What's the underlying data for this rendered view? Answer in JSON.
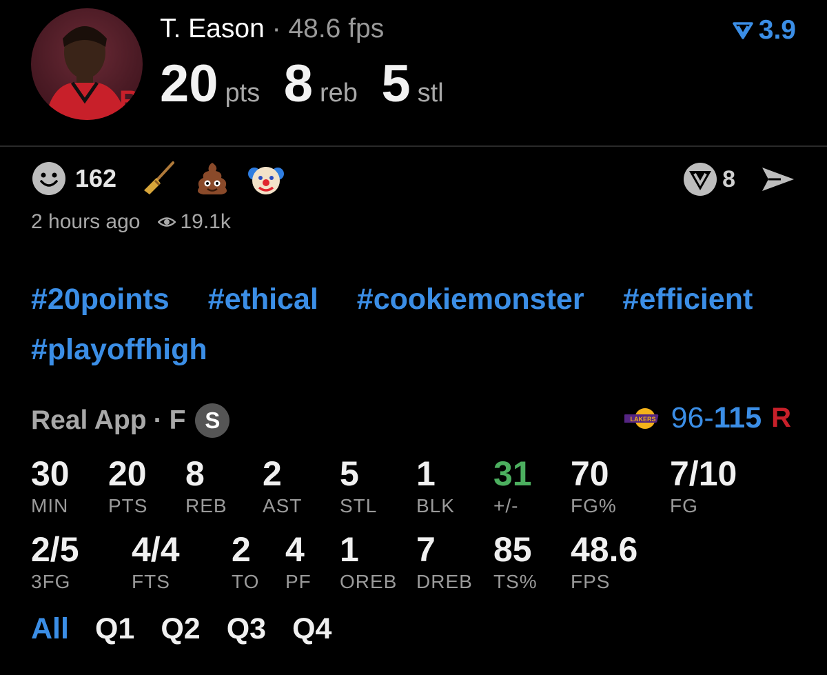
{
  "header": {
    "player_name": "T. Eason",
    "separator": "·",
    "fps_text": "48.6 fps",
    "pts_value": "20",
    "pts_label": "pts",
    "reb_value": "8",
    "reb_label": "reb",
    "stl_value": "5",
    "stl_label": "stl",
    "rating": "3.9",
    "rating_icon": "rating-chevron-icon",
    "team_logo_letter": "R"
  },
  "reactions": {
    "smiley_icon": "smiley-icon",
    "count": "162",
    "emojis": [
      "broom-emoji",
      "poop-emoji",
      "clown-emoji"
    ]
  },
  "meta": {
    "time_ago": "2 hours ago",
    "views_icon": "eye-icon",
    "views": "19.1k"
  },
  "share": {
    "shield_icon": "shield-icon",
    "count": "8",
    "send_icon": "send-icon"
  },
  "tags": [
    "#20points",
    "#ethical",
    "#cookiemonster",
    "#efficient",
    "#playoffhigh"
  ],
  "game": {
    "source": "Real App",
    "separator": "·",
    "status": "F",
    "badge": "S",
    "away_logo": "lakers-logo",
    "away_score": "96",
    "dash": "-",
    "home_score": "115",
    "home_logo": "rockets-logo",
    "lakers_text": "LAKERS"
  },
  "stats_row1": [
    {
      "value": "30",
      "label": "MIN"
    },
    {
      "value": "20",
      "label": "PTS"
    },
    {
      "value": "8",
      "label": "REB"
    },
    {
      "value": "2",
      "label": "AST"
    },
    {
      "value": "5",
      "label": "STL"
    },
    {
      "value": "1",
      "label": "BLK"
    },
    {
      "value": "31",
      "label": "+/-",
      "color": "#4caf5f"
    },
    {
      "value": "70",
      "label": "FG%"
    },
    {
      "value": "7/10",
      "label": "FG"
    }
  ],
  "stats_row2": [
    {
      "value": "2/5",
      "label": "3FG"
    },
    {
      "value": "4/4",
      "label": "FTS"
    },
    {
      "value": "2",
      "label": "TO"
    },
    {
      "value": "4",
      "label": "PF"
    },
    {
      "value": "1",
      "label": "OREB"
    },
    {
      "value": "7",
      "label": "DREB"
    },
    {
      "value": "85",
      "label": "TS%"
    },
    {
      "value": "48.6",
      "label": "FPS"
    }
  ],
  "quarters": {
    "active": "All",
    "tabs": [
      "All",
      "Q1",
      "Q2",
      "Q3",
      "Q4"
    ]
  },
  "colors": {
    "accent": "#3b8ee6",
    "positive": "#4caf5f",
    "background": "#000000"
  }
}
